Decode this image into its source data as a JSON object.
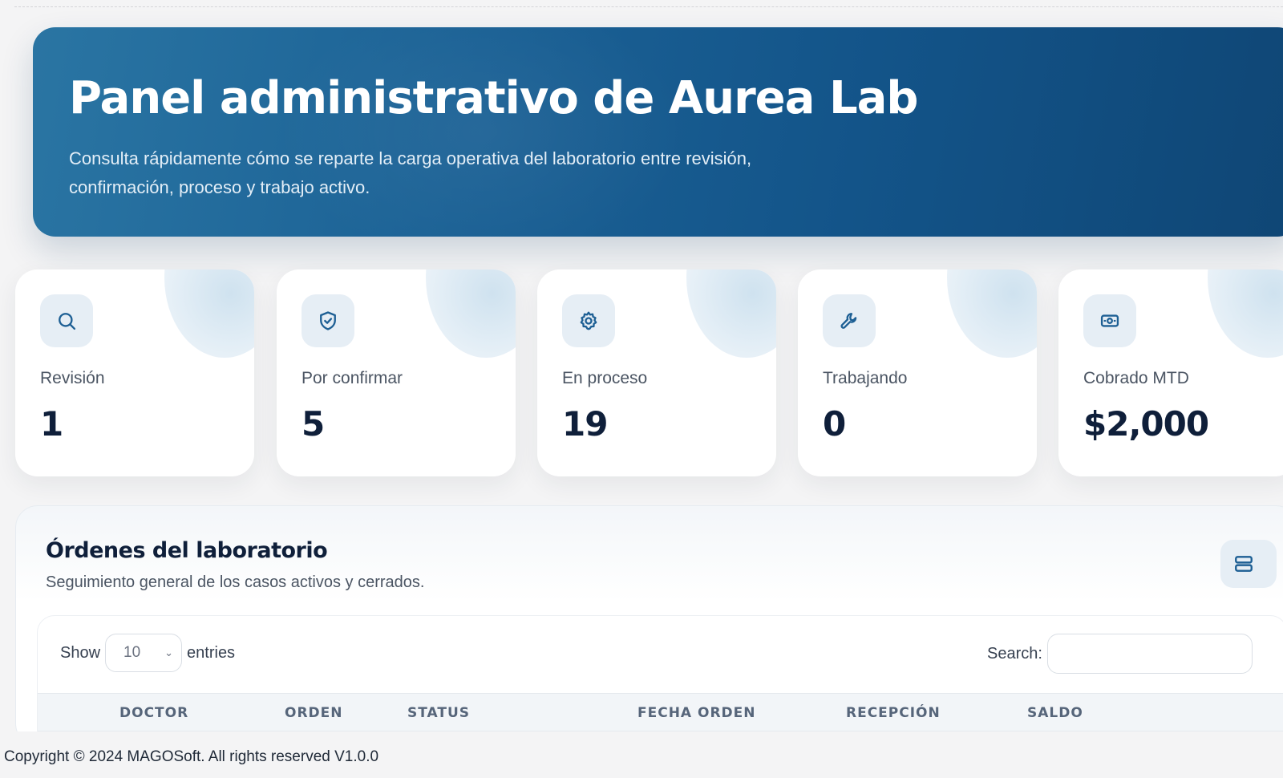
{
  "hero": {
    "title": "Panel administrativo de Aurea Lab",
    "subtitle": "Consulta rápidamente cómo se reparte la carga operativa del laboratorio entre revisión, confirmación, proceso y trabajo activo."
  },
  "stats": [
    {
      "icon": "search-icon",
      "label": "Revisión",
      "value": "1"
    },
    {
      "icon": "shield-check-icon",
      "label": "Por confirmar",
      "value": "5"
    },
    {
      "icon": "gear-icon",
      "label": "En proceso",
      "value": "19"
    },
    {
      "icon": "wrench-icon",
      "label": "Trabajando",
      "value": "0"
    },
    {
      "icon": "money-icon",
      "label": "Cobrado MTD",
      "value": "$2,000"
    }
  ],
  "orders": {
    "title": "Órdenes del laboratorio",
    "subtitle": "Seguimiento general de los casos activos y cerrados.",
    "layout_icon": "layout-rows-icon",
    "show_label": "Show",
    "entries_value": "10",
    "entries_label": "entries",
    "search_label": "Search:",
    "search_value": "",
    "columns": [
      "DOCTOR",
      "ORDEN",
      "STATUS",
      "FECHA ORDEN",
      "RECEPCIÓN",
      "SALDO"
    ]
  },
  "footer": {
    "text": "Copyright © 2024 MAGOSoft. All rights reserved V1.0.0"
  },
  "colors": {
    "accent": "#1d5f94",
    "hero_start": "#2a75a3",
    "hero_end": "#0f4675",
    "icon_bg": "#e6eef5"
  }
}
